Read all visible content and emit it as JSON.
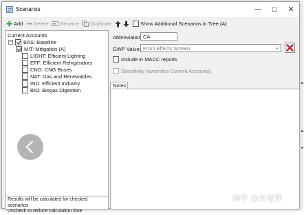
{
  "window": {
    "title": "Scenarios"
  },
  "toolbar": {
    "add": "Add",
    "delete": "Delete",
    "rename": "Rename",
    "duplicate": "Duplicate",
    "show_additional": "Show Additional Scenarios in Tree (A)",
    "show_additional_checked": false
  },
  "tree": {
    "header": "Current Accounts",
    "root": {
      "label": "BAS: Baseline",
      "checked": true
    },
    "children": [
      {
        "label": "MIT: Mitigation (A)",
        "checked": true
      },
      {
        "label": "LIGHT: Efficient Lighting",
        "checked": false
      },
      {
        "label": "EFF: Efficient Refrigerators",
        "checked": false
      },
      {
        "label": "CNG: CNG Buses",
        "checked": false
      },
      {
        "label": "NAT: Gas and Renewables",
        "checked": false
      },
      {
        "label": "IND: Efficient Industry",
        "checked": false
      },
      {
        "label": "BIO: Biogas Digestion",
        "checked": false
      }
    ],
    "footer_line1": "Results will be calculated for checked scenarios",
    "footer_line2": "Uncheck to reduce calculation time"
  },
  "details": {
    "abbreviation_label": "Abbreviation:",
    "abbreviation_value": "CA",
    "gwp_label": "GWP Values:",
    "gwp_value": "From Effects Screen",
    "include_macc": "Include in MACC reports",
    "sensitivity": "Sensitivity (overrides Current Accounts)",
    "notes_tab": "Notes"
  },
  "watermark": "知乎 @肖老师",
  "colors": {
    "accent_red": "#c8202a",
    "check_green": "#2e9b3c"
  }
}
